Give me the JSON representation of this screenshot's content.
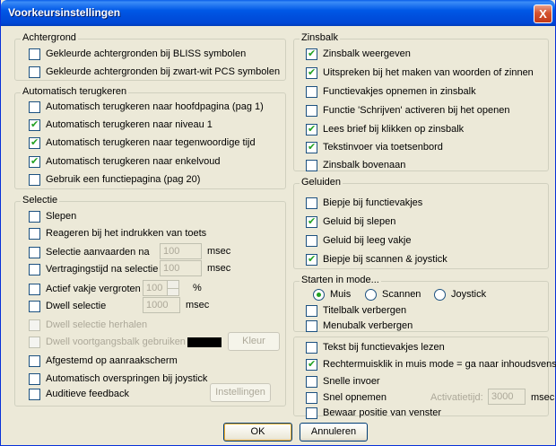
{
  "window": {
    "title": "Voorkeursinstellingen",
    "close_glyph": "X"
  },
  "achtergrond": {
    "legend": "Achtergrond",
    "items": [
      {
        "label": "Gekleurde achtergronden bij BLISS symbolen",
        "checked": false
      },
      {
        "label": "Gekleurde achtergronden bij zwart-wit PCS symbolen",
        "checked": false
      }
    ]
  },
  "auto_terug": {
    "legend": "Automatisch terugkeren",
    "items": [
      {
        "label": "Automatisch terugkeren naar hoofdpagina (pag 1)",
        "checked": false
      },
      {
        "label": "Automatisch terugkeren naar niveau 1",
        "checked": true
      },
      {
        "label": "Automatisch terugkeren naar tegenwoordige tijd",
        "checked": true
      },
      {
        "label": "Automatisch terugkeren naar enkelvoud",
        "checked": true
      },
      {
        "label": "Gebruik een functiepagina (pag 20)",
        "checked": false
      }
    ]
  },
  "selectie": {
    "legend": "Selectie",
    "slepen": "Slepen",
    "reageren": "Reageren bij het indrukken van toets",
    "aanvaarden": "Selectie aanvaarden na",
    "aanvaarden_value": "100",
    "vertraging": "Vertragingstijd na selectie",
    "vertraging_value": "100",
    "msec": "msec",
    "vergroten": "Actief vakje vergroten",
    "vergroten_value": "100",
    "percent": "%",
    "dwell": "Dwell selectie",
    "dwell_value": "1000",
    "dwell_herhalen": "Dwell selectie herhalen",
    "dwell_voortgang": "Dwell voortgangsbalk gebruiken",
    "kleur_button": "Kleur",
    "afgestemd": "Afgestemd op aanraakscherm",
    "overspringen": "Automatisch overspringen bij joystick",
    "auditief": "Auditieve feedback",
    "instellingen_button": "Instellingen"
  },
  "zinsbalk": {
    "legend": "Zinsbalk",
    "items": [
      {
        "label": "Zinsbalk weergeven",
        "checked": true
      },
      {
        "label": "Uitspreken bij het maken van woorden of zinnen",
        "checked": true
      },
      {
        "label": "Functievakjes opnemen in zinsbalk",
        "checked": false
      },
      {
        "label": "Functie 'Schrijven' activeren bij het openen",
        "checked": false
      },
      {
        "label": "Lees brief bij klikken op zinsbalk",
        "checked": true
      },
      {
        "label": "Tekstinvoer via toetsenbord",
        "checked": true
      },
      {
        "label": "Zinsbalk bovenaan",
        "checked": false
      }
    ]
  },
  "geluiden": {
    "legend": "Geluiden",
    "items": [
      {
        "label": "Biepje bij functievakjes",
        "checked": false
      },
      {
        "label": "Geluid bij slepen",
        "checked": true
      },
      {
        "label": "Geluid bij leeg vakje",
        "checked": false
      },
      {
        "label": "Biepje bij scannen & joystick",
        "checked": true
      }
    ]
  },
  "starten": {
    "legend": "Starten in mode...",
    "modes": [
      "Muis",
      "Scannen",
      "Joystick"
    ],
    "selected_mode": "Muis",
    "titelbalk": "Titelbalk verbergen",
    "menubalk": "Menubalk verbergen"
  },
  "overig": {
    "tekst_lezen": "Tekst bij functievakjes lezen",
    "rechtermuis": "Rechtermuisklik in muis mode = ga naar inhoudsvenster",
    "snelle_invoer": "Snelle invoer",
    "snel_opnemen": "Snel opnemen",
    "activatietijd_label": "Activatietijd:",
    "activatietijd_value": "3000",
    "msec": "msec",
    "bewaar_positie": "Bewaar positie van venster"
  },
  "footer": {
    "ok": "OK",
    "annuleren": "Annuleren"
  },
  "colors": {
    "title_bar": "#0058e6",
    "dialog_bg": "#ece9d8",
    "check_mark": "#21a121",
    "kleur_swatch": "#000000"
  }
}
